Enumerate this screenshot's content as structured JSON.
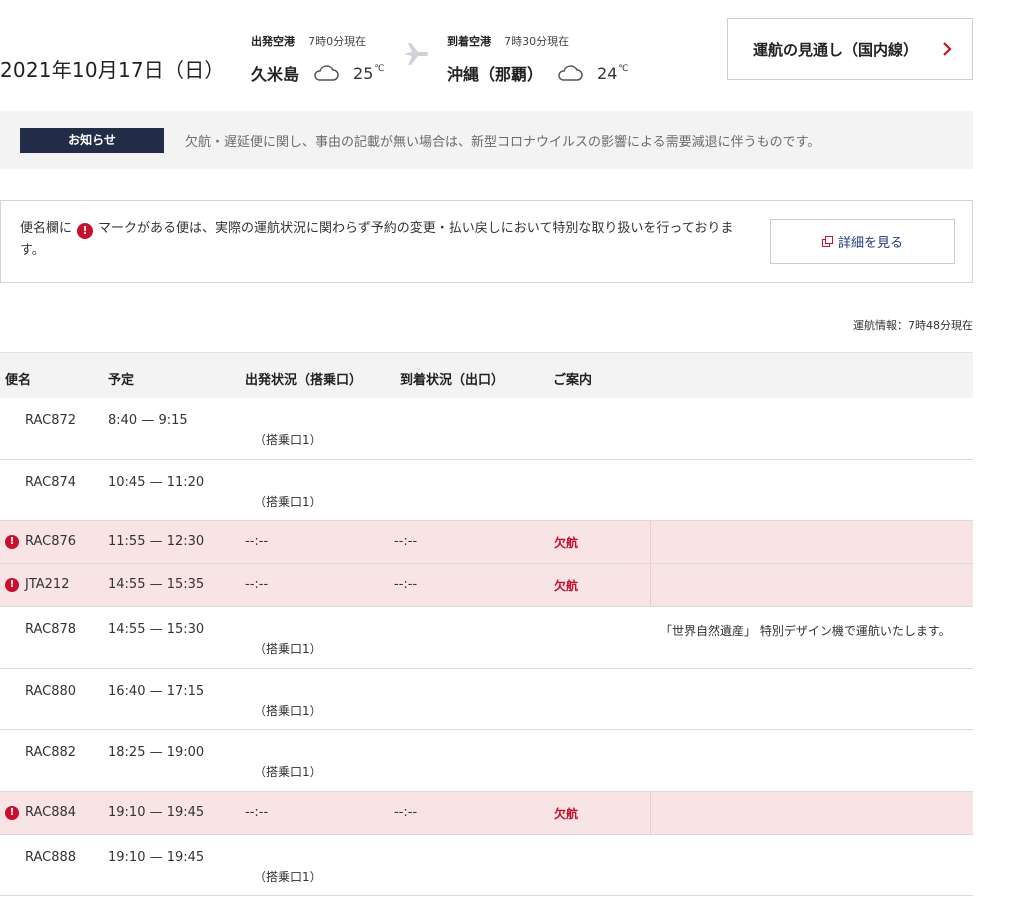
{
  "header": {
    "date": "2021年10月17日（日）",
    "departure": {
      "label": "出発空港",
      "asof": "7時0分現在",
      "name": "久米島",
      "weather_icon": "cloud-icon",
      "temp": "25",
      "unit": "℃"
    },
    "arrival": {
      "label": "到着空港",
      "asof": "7時30分現在",
      "name": "沖縄（那覇）",
      "weather_icon": "cloud-icon",
      "temp": "24",
      "unit": "℃"
    },
    "outlook_button": "運航の見通し（国内線）"
  },
  "notice": {
    "tag": "お知らせ",
    "message": "欠航・遅延便に関し、事由の記載が無い場合は、新型コロナウイルスの影響による需要減退に伴うものです。"
  },
  "info": {
    "text_before": "便名欄に",
    "text_after": "マークがある便は、実際の運航状況に関わらず予約の変更・払い戻しにおいて特別な取り扱いを行っております。",
    "mark": "!",
    "detail_button": "詳細を見る"
  },
  "asof": "運航情報：7時48分現在",
  "table": {
    "headers": {
      "flight": "便名",
      "schedule": "予定",
      "departure": "出発状況（搭乗口）",
      "arrival": "到着状況（出口）",
      "info": "ご案内"
    },
    "rows": [
      {
        "flight": "RAC872",
        "schedule": "8:40 — 9:15",
        "gate": "（搭乗口1）"
      },
      {
        "flight": "RAC874",
        "schedule": "10:45 — 11:20",
        "gate": "（搭乗口1）"
      },
      {
        "flight": "RAC876",
        "schedule": "11:55 — 12:30",
        "dep": "--:--",
        "arr": "--:--",
        "status": "欠航",
        "mark": "!"
      },
      {
        "flight": "JTA212",
        "schedule": "14:55 — 15:35",
        "dep": "--:--",
        "arr": "--:--",
        "status": "欠航",
        "mark": "!"
      },
      {
        "flight": "RAC878",
        "schedule": "14:55 — 15:30",
        "gate": "（搭乗口1）",
        "note": "「世界自然遺産」 特別デザイン機で運航いたします。"
      },
      {
        "flight": "RAC880",
        "schedule": "16:40 — 17:15",
        "gate": "（搭乗口1）"
      },
      {
        "flight": "RAC882",
        "schedule": "18:25 — 19:00",
        "gate": "（搭乗口1）"
      },
      {
        "flight": "RAC884",
        "schedule": "19:10 — 19:45",
        "dep": "--:--",
        "arr": "--:--",
        "status": "欠航",
        "mark": "!"
      },
      {
        "flight": "RAC888",
        "schedule": "19:10 — 19:45",
        "gate": "（搭乗口1）"
      }
    ]
  }
}
